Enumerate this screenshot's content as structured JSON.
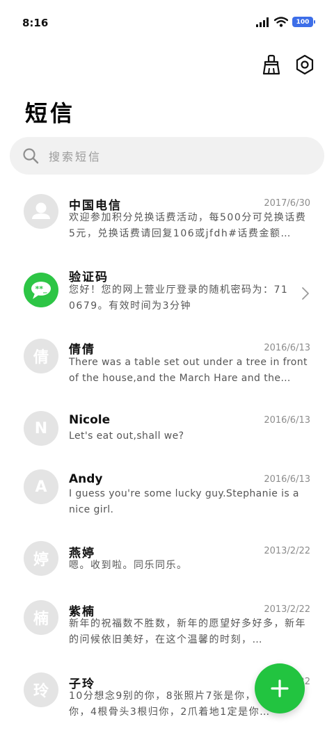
{
  "status_bar": {
    "time": "8:16",
    "battery": "100",
    "icons": [
      "signal-icon",
      "wifi-icon",
      "battery-icon"
    ]
  },
  "header": {
    "title": "短信",
    "actions": [
      "broom-icon",
      "settings-icon"
    ]
  },
  "search": {
    "placeholder": "搜索短信"
  },
  "messages": [
    {
      "sender": "中国电信",
      "date": "2017/6/30",
      "preview": "欢迎参加积分兑换话费活动，每500分可兑换话费5元，兑换话费请回复106或jfdh#话费金额…",
      "avatar": "person-icon"
    },
    {
      "sender": "验证码",
      "date": "",
      "preview": "您好！您的网上营业厅登录的随机密码为：710679。有效时间为3分钟",
      "avatar": "chat-bubble-icon"
    },
    {
      "sender": "倩倩",
      "date": "2016/6/13",
      "preview": "There was a table set out under a tree in front of the house,and the March Hare and the Hatte…",
      "avatar": "倩"
    },
    {
      "sender": "Nicole",
      "date": "2016/6/13",
      "preview": "Let's eat out,shall we?",
      "avatar": "N"
    },
    {
      "sender": "Andy",
      "date": "2016/6/13",
      "preview": "I guess you're some lucky guy.Stephanie is a nice girl.",
      "avatar": "A"
    },
    {
      "sender": "燕婷",
      "date": "2013/2/22",
      "preview": "嗯。收到啦。同乐同乐。",
      "avatar": "婷"
    },
    {
      "sender": "紫楠",
      "date": "2013/2/22",
      "preview": "新年的祝福数不胜数，新年的愿望好多好多，新年的问候依旧美好，在这个温馨的时刻，…",
      "avatar": "楠"
    },
    {
      "sender": "子玲",
      "date": "2013/2/22",
      "preview": "10分想念9别的你，8张照片7张是你，6天5只像你，4根骨头3根归你，2爪着地1定是你…",
      "avatar": "玲"
    }
  ],
  "fab": {
    "icon": "plus-icon"
  },
  "colors": {
    "accent_green": "#22c440",
    "avatar_grey": "#e4e4e4",
    "battery_blue": "#3d6ee8"
  }
}
